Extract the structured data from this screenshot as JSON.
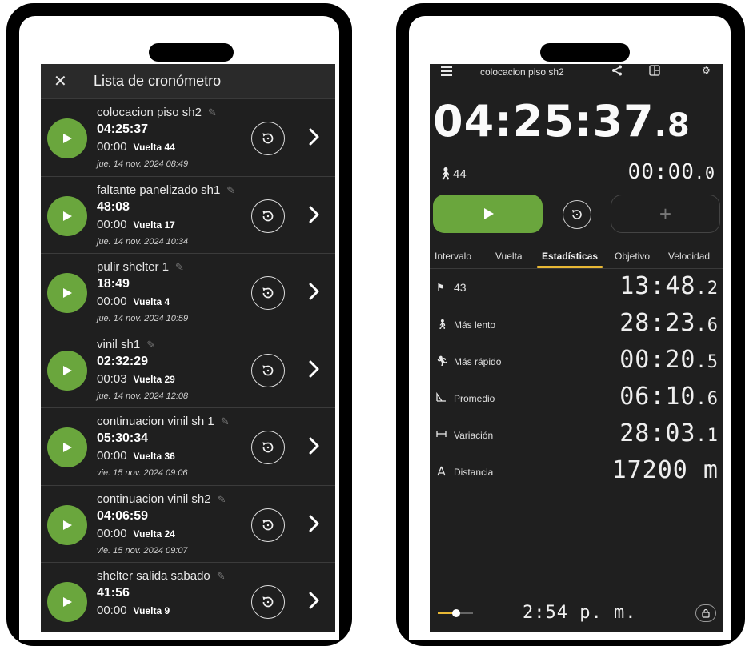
{
  "left_app": {
    "close_icon": "close-icon",
    "title": "Lista de cronómetro",
    "rows": [
      {
        "name": "colocacion piso sh2",
        "total": "04:25:37",
        "lap_time": "00:00",
        "lap_label": "Vuelta 44",
        "date": "jue. 14 nov. 2024 08:49"
      },
      {
        "name": "faltante panelizado sh1",
        "total": "48:08",
        "lap_time": "00:00",
        "lap_label": "Vuelta 17",
        "date": "jue. 14 nov. 2024 10:34"
      },
      {
        "name": "pulir shelter 1",
        "total": "18:49",
        "lap_time": "00:00",
        "lap_label": "Vuelta 4",
        "date": "jue. 14 nov. 2024 10:59"
      },
      {
        "name": "vinil sh1",
        "total": "02:32:29",
        "lap_time": "00:03",
        "lap_label": "Vuelta 29",
        "date": "jue. 14 nov. 2024 12:08"
      },
      {
        "name": "continuacion vinil sh 1",
        "total": "05:30:34",
        "lap_time": "00:00",
        "lap_label": "Vuelta 36",
        "date": "vie. 15 nov. 2024 09:06"
      },
      {
        "name": "continuacion vinil sh2",
        "total": "04:06:59",
        "lap_time": "00:00",
        "lap_label": "Vuelta 24",
        "date": "vie. 15 nov. 2024 09:07"
      },
      {
        "name": "shelter salida sabado",
        "total": "41:56",
        "lap_time": "00:00",
        "lap_label": "Vuelta 9",
        "date": ""
      }
    ]
  },
  "right_app": {
    "timer_name": "colocacion piso sh2",
    "main_time": "04:25:37",
    "main_tenth": ".8",
    "lap_count": "44",
    "lap_time": "00:00",
    "lap_tenth": ".0",
    "add_lap_label": "+",
    "tabs": [
      "Intervalo",
      "Vuelta",
      "Estadísticas",
      "Objetivo",
      "Velocidad"
    ],
    "active_tab": "Estadísticas",
    "stats": [
      {
        "icon": "flag-icon",
        "label": "43",
        "value": "13:48",
        "tenth": ".2"
      },
      {
        "icon": "slow-runner-icon",
        "label": "Más lento",
        "value": "28:23",
        "tenth": ".6"
      },
      {
        "icon": "fast-runner-icon",
        "label": "Más rápido",
        "value": "00:20",
        "tenth": ".5"
      },
      {
        "icon": "average-icon",
        "label": "Promedio",
        "value": "06:10",
        "tenth": ".6"
      },
      {
        "icon": "range-icon",
        "label": "Variación",
        "value": "28:03",
        "tenth": ".1"
      },
      {
        "icon": "distance-icon",
        "label": "Distancia",
        "value": "17200 m",
        "tenth": ""
      }
    ],
    "clock": "2:54 p. m.",
    "slider_level": 0.5,
    "accent_color": "#e8b835",
    "green_color": "#6aa63d"
  }
}
